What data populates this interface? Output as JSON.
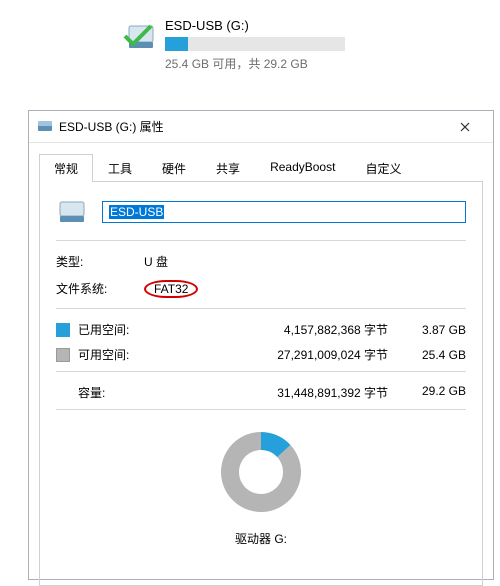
{
  "summary": {
    "title": "ESD-USB (G:)",
    "free_text": "25.4 GB 可用，共 29.2 GB",
    "used_percent": 13
  },
  "dialog": {
    "title": "ESD-USB (G:) 属性",
    "tabs": [
      {
        "label": "常规",
        "active": true
      },
      {
        "label": "工具",
        "active": false
      },
      {
        "label": "硬件",
        "active": false
      },
      {
        "label": "共享",
        "active": false
      },
      {
        "label": "ReadyBoost",
        "active": false
      },
      {
        "label": "自定义",
        "active": false
      }
    ],
    "name_value": "ESD-USB",
    "type_label": "类型:",
    "type_value": "U 盘",
    "fs_label": "文件系统:",
    "fs_value": "FAT32",
    "used": {
      "label": "已用空间:",
      "bytes": "4,157,882,368 字节",
      "gb": "3.87 GB"
    },
    "free": {
      "label": "可用空间:",
      "bytes": "27,291,009,024 字节",
      "gb": "25.4 GB"
    },
    "capacity": {
      "label": "容量:",
      "bytes": "31,448,891,392 字节",
      "gb": "29.2 GB"
    },
    "drive_label": "驱动器 G:"
  },
  "chart_data": {
    "type": "pie",
    "title": "驱动器 G:",
    "series": [
      {
        "name": "已用空间",
        "value": 3.87,
        "color": "#26a0da"
      },
      {
        "name": "可用空间",
        "value": 25.4,
        "color": "#b5b5b5"
      }
    ],
    "total": 29.2,
    "unit": "GB"
  }
}
